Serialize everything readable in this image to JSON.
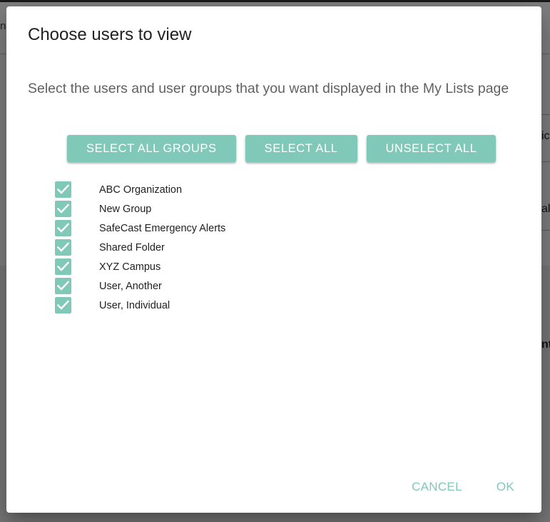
{
  "background": {
    "top_left_fragment": "n",
    "right_fragment_1": "ic",
    "right_fragment_2": "al",
    "right_fragment_3": "nt"
  },
  "dialog": {
    "title": "Choose users to view",
    "description": "Select the users and user groups that you want displayed in the My Lists page",
    "buttons": {
      "select_all_groups": "SELECT ALL GROUPS",
      "select_all": "SELECT ALL",
      "unselect_all": "UNSELECT ALL"
    },
    "users": [
      {
        "label": "ABC Organization",
        "checked": true
      },
      {
        "label": "New Group",
        "checked": true
      },
      {
        "label": "SafeCast Emergency Alerts",
        "checked": true
      },
      {
        "label": "Shared Folder",
        "checked": true
      },
      {
        "label": "XYZ Campus",
        "checked": true
      },
      {
        "label": "User, Another",
        "checked": true
      },
      {
        "label": "User, Individual",
        "checked": true
      }
    ],
    "actions": {
      "cancel": "CANCEL",
      "ok": "OK"
    }
  },
  "colors": {
    "accent": "#80c8b8",
    "title_text": "#212121",
    "description_text": "#616161"
  }
}
